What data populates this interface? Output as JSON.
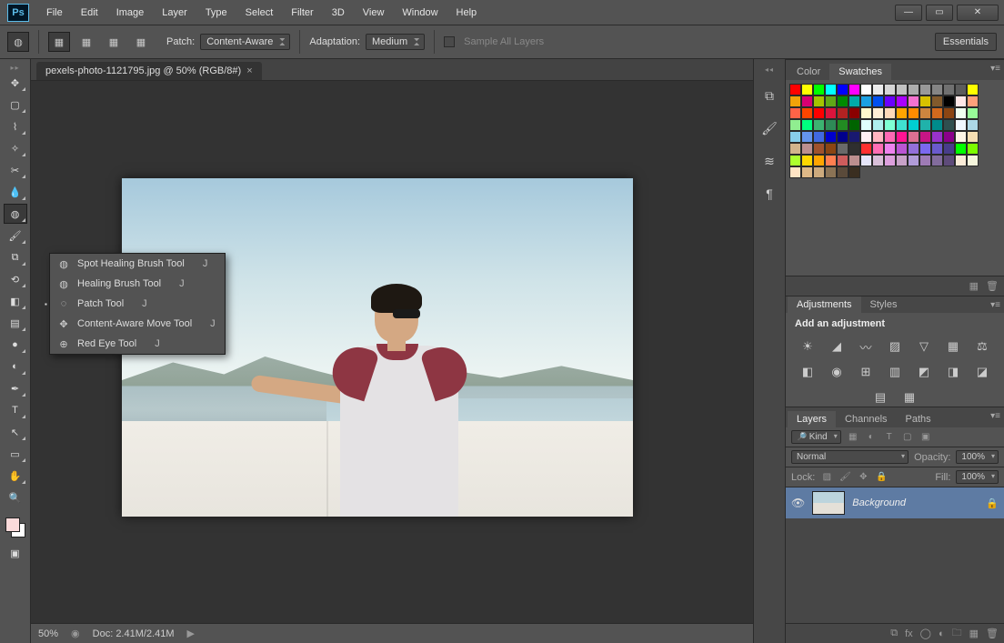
{
  "app": {
    "logo": "Ps"
  },
  "menu": [
    "File",
    "Edit",
    "Image",
    "Layer",
    "Type",
    "Select",
    "Filter",
    "3D",
    "View",
    "Window",
    "Help"
  ],
  "options": {
    "patch_label": "Patch:",
    "patch_value": "Content-Aware",
    "adapt_label": "Adaptation:",
    "adapt_value": "Medium",
    "sample_label": "Sample All Layers",
    "workspace": "Essentials"
  },
  "document": {
    "tab_title": "pexels-photo-1121795.jpg @ 50% (RGB/8#)",
    "zoom": "50%",
    "doc_size": "Doc: 2.41M/2.41M"
  },
  "flyout": [
    {
      "label": "Spot Healing Brush Tool",
      "key": "J"
    },
    {
      "label": "Healing Brush Tool",
      "key": "J"
    },
    {
      "label": "Patch Tool",
      "key": "J",
      "selected": true
    },
    {
      "label": "Content-Aware Move Tool",
      "key": "J"
    },
    {
      "label": "Red Eye Tool",
      "key": "J"
    }
  ],
  "swatch_colors": [
    "#ff0000",
    "#ffff00",
    "#00ff00",
    "#00ffff",
    "#0000ff",
    "#ff00ff",
    "#ffffff",
    "#ebebeb",
    "#d6d6d6",
    "#c2c2c2",
    "#adadad",
    "#999999",
    "#858585",
    "#707070",
    "#5c5c5c",
    "#ffff00",
    "#f0a30a",
    "#d80073",
    "#a4c400",
    "#60a917",
    "#008a00",
    "#00aba9",
    "#1ba1e2",
    "#0050ef",
    "#6a00ff",
    "#aa00ff",
    "#f472d0",
    "#d8c100",
    "#825a2c",
    "#000000",
    "#ffe7e7",
    "#ffa07a",
    "#ff6347",
    "#ff4500",
    "#ff0000",
    "#dc143c",
    "#b22222",
    "#8b0000",
    "#fffacd",
    "#ffefd5",
    "#ffdab9",
    "#ffa500",
    "#ff8c00",
    "#cd853f",
    "#d2691e",
    "#8b4513",
    "#f0fff0",
    "#98fb98",
    "#90ee90",
    "#00ff7f",
    "#3cb371",
    "#2e8b57",
    "#228b22",
    "#006400",
    "#e0ffff",
    "#afeeee",
    "#7fffd4",
    "#40e0d0",
    "#00ced1",
    "#20b2aa",
    "#008b8b",
    "#2f4f4f",
    "#f0f8ff",
    "#add8e6",
    "#87ceeb",
    "#6495ed",
    "#4169e1",
    "#0000cd",
    "#00008b",
    "#191970",
    "#fff0f5",
    "#ffb6c1",
    "#ff69b4",
    "#ff1493",
    "#db7093",
    "#c71585",
    "#9932cc",
    "#8b008b",
    "#fdf5e6",
    "#f5deb3",
    "#d2b48c",
    "#bc8f8f",
    "#a0522d",
    "#8b4513",
    "#696969",
    "#2f2f2f",
    "#ff3030",
    "#ff6eb4",
    "#ee82ee",
    "#ba55d3",
    "#9370db",
    "#7b68ee",
    "#6a5acd",
    "#483d8b",
    "#00ff00",
    "#7cfc00",
    "#adff2f",
    "#ffd700",
    "#ffa500",
    "#ff7f50",
    "#cd5c5c",
    "#bc8f8f",
    "#e6e6fa",
    "#d8bfd8",
    "#dda0dd",
    "#c8a2c8",
    "#b19cd9",
    "#9e7bb5",
    "#826c9c",
    "#5e4b7a",
    "#faebd7",
    "#f5f5dc",
    "#ffe4c4",
    "#deb887",
    "#cdaa7d",
    "#8b7355",
    "#5a4a3a",
    "#3a2e20"
  ],
  "panels": {
    "color_tab": "Color",
    "swatches_tab": "Swatches",
    "adjustments_tab": "Adjustments",
    "styles_tab": "Styles",
    "add_adjustment": "Add an adjustment",
    "layers_tab": "Layers",
    "channels_tab": "Channels",
    "paths_tab": "Paths",
    "kind_label": "Kind",
    "blend_mode": "Normal",
    "opacity_label": "Opacity:",
    "opacity_value": "100%",
    "lock_label": "Lock:",
    "fill_label": "Fill:",
    "fill_value": "100%",
    "layer_name": "Background"
  }
}
